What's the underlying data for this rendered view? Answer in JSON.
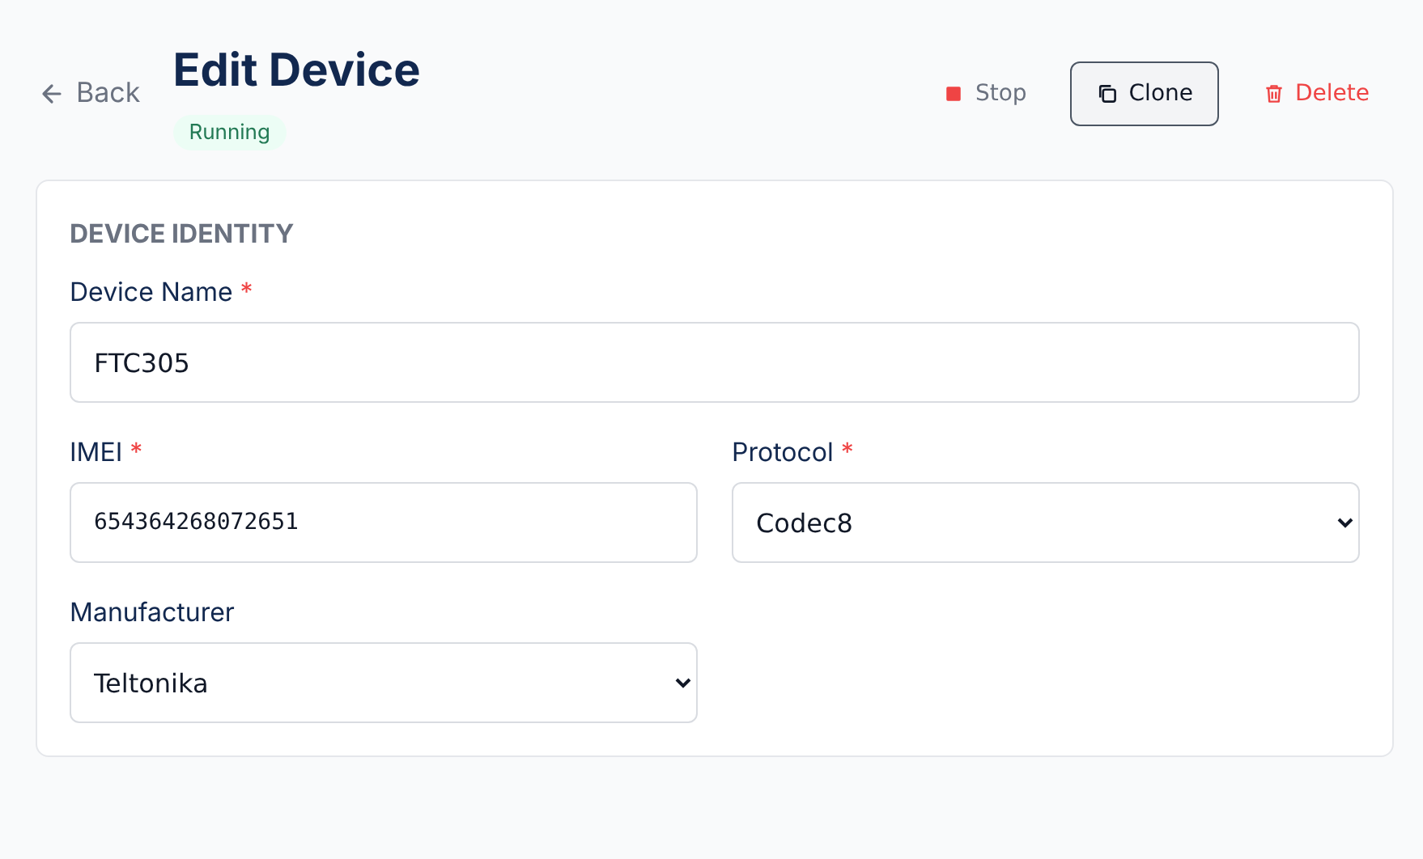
{
  "back": {
    "label": "Back"
  },
  "title": "Edit Device",
  "status": {
    "label": "Running",
    "kind": "running"
  },
  "actions": [
    {
      "label": "Stop",
      "kind": "stop"
    },
    {
      "label": "Clone",
      "kind": "clone"
    },
    {
      "label": "Delete",
      "kind": "delete"
    }
  ],
  "section": {
    "title": "DEVICE IDENTITY",
    "rows": [
      [
        {
          "label": "Device Name",
          "required_mark": "*",
          "kind": "text",
          "value": "FTC305"
        }
      ],
      [
        {
          "label": "IMEI",
          "required_mark": "*",
          "kind": "mono",
          "value": "654364268072651"
        },
        {
          "label": "Protocol",
          "required_mark": "*",
          "kind": "select",
          "value": "Codec8"
        }
      ],
      [
        {
          "label": "Manufacturer",
          "kind": "select",
          "value": "Teltonika"
        }
      ]
    ]
  }
}
